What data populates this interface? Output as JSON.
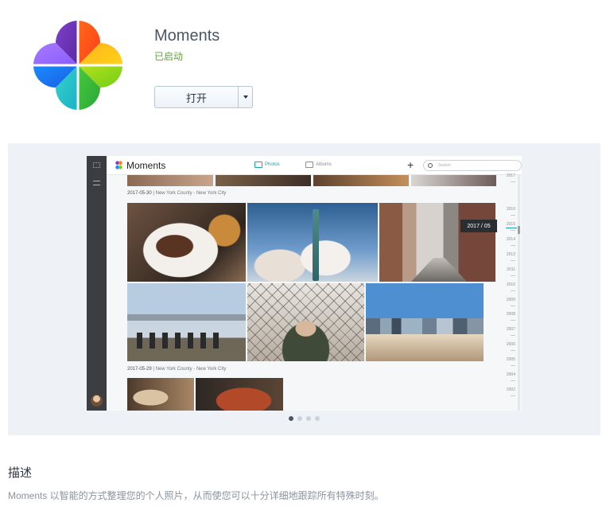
{
  "app": {
    "title": "Moments",
    "status": "已启动",
    "open_label": "打开"
  },
  "colors": {
    "status_green": "#62a53a",
    "title": "#4a5666",
    "gallery_bg": "#eef2f7",
    "accent_teal": "#1ea3a8"
  },
  "screenshot": {
    "brand": "Moments",
    "tabs": [
      "Photos",
      "Albums"
    ],
    "plus": "+",
    "search_placeholder": "Search",
    "groups": [
      {
        "date": "2017-05-30",
        "place": "New York County - New York City"
      },
      {
        "date": "2017-05-29",
        "place": "New York County - New York City"
      }
    ],
    "tooltip": "2017 / 05",
    "timeline_years": [
      "2017",
      "2016",
      "2015",
      "2014",
      "2013",
      "2011",
      "2010",
      "2009",
      "2008",
      "2007",
      "2006",
      "2005",
      "2004",
      "2002"
    ]
  },
  "gallery": {
    "slide_count": 4,
    "active_slide": 1
  },
  "description": {
    "heading": "描述",
    "text": "Moments 以智能的方式整理您的个人照片，从而使您可以十分详细地跟踪所有特殊时刻。"
  }
}
